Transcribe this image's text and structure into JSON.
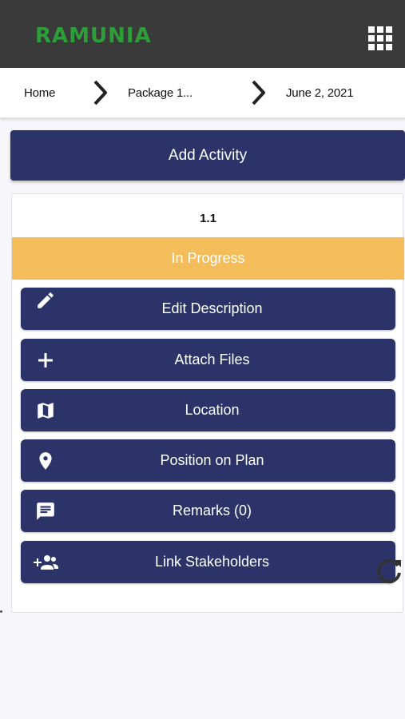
{
  "header": {
    "logo_text": "RAMUNIA",
    "logo_tagline": "",
    "menu_icon": "apps-grid-icon"
  },
  "breadcrumb": {
    "items": [
      "Home",
      "Package 1...",
      "June 2, 2021"
    ],
    "separator_icon": "chevron-right-icon"
  },
  "add_activity": {
    "label": "Add Activity"
  },
  "activity": {
    "number": "1.1",
    "status": "In Progress",
    "actions": [
      {
        "label": "Edit Description",
        "icon": "pencil-icon"
      },
      {
        "label": "Attach Files",
        "icon": "plus-icon"
      },
      {
        "label": "Location",
        "icon": "map-icon"
      },
      {
        "label": "Position on Plan",
        "icon": "map-pin-icon"
      },
      {
        "label": "Remarks (0)",
        "icon": "comment-icon"
      },
      {
        "label": "Link Stakeholders",
        "icon": "add-people-icon"
      }
    ]
  },
  "colors": {
    "topbar": "#3a3a3a",
    "logo_green": "#2e9e3a",
    "primary_navy": "#2b3369",
    "status_in_progress": "#f5bd59",
    "background": "#f7f6fa"
  }
}
